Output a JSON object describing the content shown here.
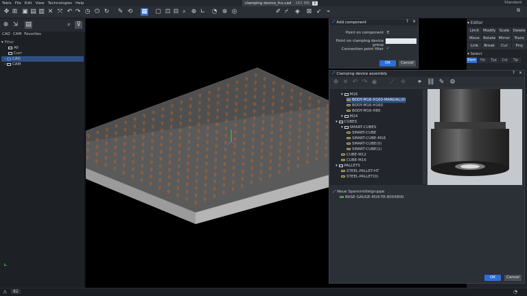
{
  "menu": [
    "Tebis",
    "File",
    "Edit",
    "View",
    "Technologies",
    "Help"
  ],
  "document": {
    "title": "clamping device_fcs.cad",
    "size": "283 MB",
    "count": "1"
  },
  "window": {
    "mode": "Standard"
  },
  "left_panel": {
    "tabs": [
      "CAD",
      "CAM",
      "Favorites"
    ],
    "filter_label": "Filter",
    "tree": [
      {
        "label": "All"
      },
      {
        "label": "Curr"
      },
      {
        "label": "CAD"
      },
      {
        "label": "CAM"
      }
    ]
  },
  "editor": {
    "title": "Editor",
    "buttons": [
      "Limit",
      "Modify",
      "Scale",
      "Delete",
      "Move",
      "Rotate",
      "Mirror",
      "Trans",
      "Link",
      "Break",
      "Cut",
      "Proj"
    ],
    "select_title": "Select",
    "select_tabs": [
      "Elem",
      "Fal",
      "Typ",
      "Col",
      "Tip"
    ]
  },
  "add_component": {
    "title": "Add component",
    "help": "?",
    "close": "×",
    "point_on_component_label": "Point on component",
    "point_on_component_value": "E",
    "point_on_group_label": "Point on clamping device group",
    "connection_filter_label": "Connection point filter",
    "connection_filter_value": "✓",
    "ok": "OK",
    "cancel": "Cancel"
  },
  "assembly": {
    "title": "Clamping device assembly",
    "help": "?",
    "close": "×",
    "tree": [
      {
        "label": "M16",
        "type": "folder",
        "level": 1
      },
      {
        "label": "BODY-M16-H100-MANUAL(0)",
        "type": "comp",
        "level": 2,
        "selected": true
      },
      {
        "label": "BODY-M16-H160",
        "type": "comp",
        "level": 2
      },
      {
        "label": "BODY-M16-H80",
        "type": "comp",
        "level": 2
      },
      {
        "label": "M24",
        "type": "folder",
        "level": 1
      },
      {
        "label": "CUBES",
        "type": "folder",
        "level": 0
      },
      {
        "label": "SMART-CUBES",
        "type": "folder",
        "level": 1
      },
      {
        "label": "SMART-CUBE",
        "type": "comp",
        "level": 2
      },
      {
        "label": "SMART-CUBE-M16",
        "type": "comp",
        "level": 2
      },
      {
        "label": "SMART-CUBE(0)",
        "type": "comp",
        "level": 2
      },
      {
        "label": "SMART-CUBE(1)",
        "type": "comp",
        "level": 2
      },
      {
        "label": "CUBE-M12",
        "type": "comp",
        "level": 1
      },
      {
        "label": "CUBE-M16",
        "type": "comp",
        "level": 1
      },
      {
        "label": "PALLETS",
        "type": "folder",
        "level": 0
      },
      {
        "label": "STEEL-PALLET-HT",
        "type": "comp",
        "level": 1
      },
      {
        "label": "STEEL-PALLET(0)",
        "type": "comp",
        "level": 1
      }
    ],
    "group_label": "Neue Spannmittelgruppe",
    "group_item": "BASE-GAUGE-M16-TR-800X800",
    "ok": "OK",
    "cancel": "Cancel"
  },
  "status": {
    "count": "82"
  },
  "colors": {
    "accent": "#2e6fd6",
    "selection": "#2f4f82",
    "clamp": "#e36a1a",
    "plate_top": "#5a5a5a",
    "plate_side": "#b5b5b5"
  }
}
